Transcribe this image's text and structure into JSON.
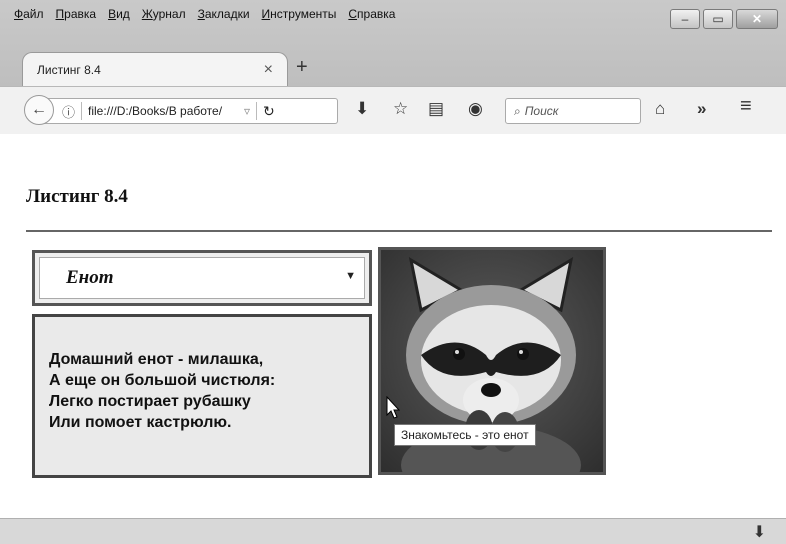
{
  "menu": [
    "Файл",
    "Правка",
    "Вид",
    "Журнал",
    "Закладки",
    "Инструменты",
    "Справка"
  ],
  "window_buttons": {
    "minimize": "–",
    "maximize": "▭",
    "close": "✕"
  },
  "tab": {
    "label": "Листинг 8.4",
    "close": "×",
    "new_tab": "+"
  },
  "navbar": {
    "url": "file:///D:/Books/В работе/",
    "search_placeholder": "Поиск",
    "overflow": "»"
  },
  "page": {
    "title": "Листинг 8.4",
    "select_value": "Енот",
    "poem": [
      "Домашний енот - милашка,",
      "А еще он большой чистюля:",
      "Легко постирает рубашку",
      "Или помоет кастрюлю."
    ],
    "image_tooltip": "Знакомьтесь - это енот"
  }
}
